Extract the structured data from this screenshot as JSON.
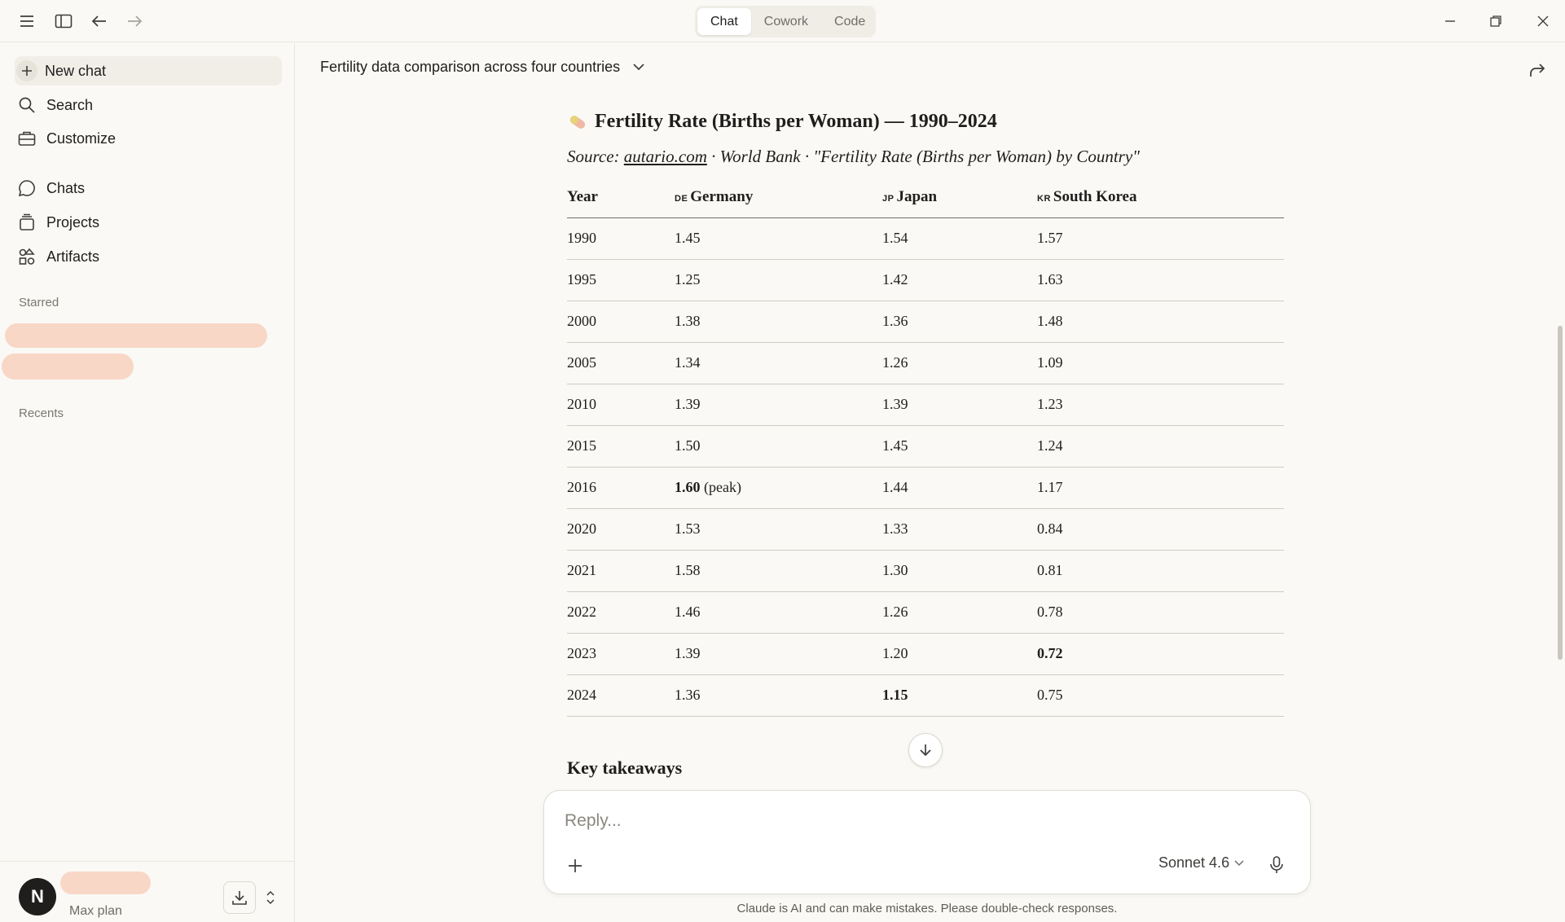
{
  "topbar": {
    "modes": [
      "Chat",
      "Cowork",
      "Code"
    ],
    "active_mode": "Chat"
  },
  "sidebar": {
    "new_chat": "New chat",
    "search": "Search",
    "customize": "Customize",
    "chats": "Chats",
    "projects": "Projects",
    "artifacts": "Artifacts",
    "starred_label": "Starred",
    "recents_label": "Recents",
    "account": {
      "avatar_initial": "N",
      "plan": "Max plan"
    }
  },
  "conversation": {
    "title": "Fertility data comparison across four countries"
  },
  "message": {
    "heading_emoji": "pill-tag-emoji",
    "heading": "Fertility Rate (Births per Woman) — 1990–2024",
    "source_prefix": "Source: ",
    "source_link": "autario.com",
    "source_rest": " · World Bank · \"Fertility Rate (Births per Woman) by Country\"",
    "table": {
      "headers": {
        "year": "Year",
        "de_flag": "DE",
        "de": "Germany",
        "jp_flag": "JP",
        "jp": "Japan",
        "kr_flag": "KR",
        "kr": "South Korea"
      },
      "rows": [
        {
          "year": "1990",
          "de": "1.45",
          "de_note": "",
          "jp": "1.54",
          "kr": "1.57"
        },
        {
          "year": "1995",
          "de": "1.25",
          "de_note": "",
          "jp": "1.42",
          "kr": "1.63"
        },
        {
          "year": "2000",
          "de": "1.38",
          "de_note": "",
          "jp": "1.36",
          "kr": "1.48"
        },
        {
          "year": "2005",
          "de": "1.34",
          "de_note": "",
          "jp": "1.26",
          "kr": "1.09"
        },
        {
          "year": "2010",
          "de": "1.39",
          "de_note": "",
          "jp": "1.39",
          "kr": "1.23"
        },
        {
          "year": "2015",
          "de": "1.50",
          "de_note": "",
          "jp": "1.45",
          "kr": "1.24"
        },
        {
          "year": "2016",
          "de": "1.60",
          "de_note": " (peak)",
          "jp": "1.44",
          "kr": "1.17"
        },
        {
          "year": "2020",
          "de": "1.53",
          "de_note": "",
          "jp": "1.33",
          "kr": "0.84"
        },
        {
          "year": "2021",
          "de": "1.58",
          "de_note": "",
          "jp": "1.30",
          "kr": "0.81"
        },
        {
          "year": "2022",
          "de": "1.46",
          "de_note": "",
          "jp": "1.26",
          "kr": "0.78"
        },
        {
          "year": "2023",
          "de": "1.39",
          "de_note": "",
          "jp": "1.20",
          "kr": "0.72"
        },
        {
          "year": "2024",
          "de": "1.36",
          "de_note": "",
          "jp": "1.15",
          "kr": "0.75"
        }
      ]
    },
    "takeaways_heading": "Key takeaways"
  },
  "composer": {
    "placeholder": "Reply...",
    "model": "Sonnet 4.6",
    "disclaimer": "Claude is AI and can make mistakes. Please double-check responses."
  }
}
